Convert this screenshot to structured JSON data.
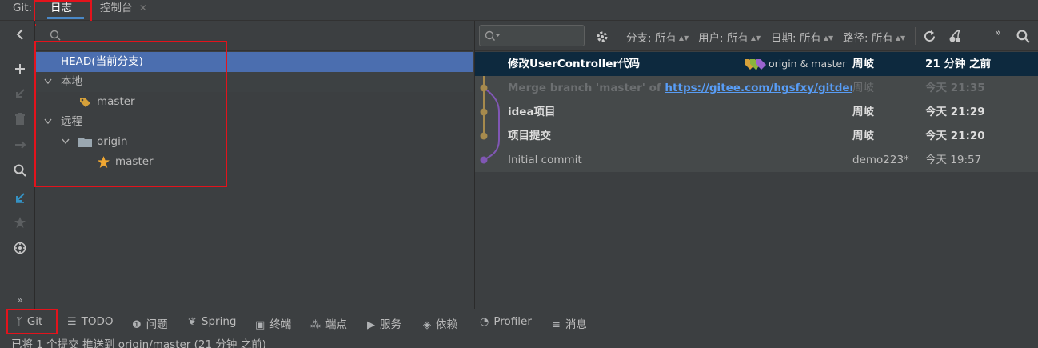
{
  "header": {
    "tool_label": "Git:",
    "tabs": [
      {
        "label": "日志",
        "active": true
      },
      {
        "label": "控制台",
        "close": "✕"
      }
    ]
  },
  "branches": {
    "items": [
      {
        "label": "HEAD(当前分支)",
        "selected": true
      },
      {
        "label": "本地",
        "expanded": true
      },
      {
        "label": "master",
        "icon": "tag-icon"
      },
      {
        "label": "远程",
        "expanded": true
      },
      {
        "label": "origin",
        "icon": "folder-icon",
        "expanded": true
      },
      {
        "label": "master",
        "icon": "star-icon"
      }
    ]
  },
  "log_toolbar": {
    "filters": [
      {
        "label": "分支: 所有"
      },
      {
        "label": "用户: 所有"
      },
      {
        "label": "日期: 所有"
      },
      {
        "label": "路径: 所有"
      }
    ]
  },
  "commits": [
    {
      "message": "修改UserController代码",
      "refs": "origin & master",
      "author": "周岐",
      "date": "21 分钟 之前",
      "bold": true,
      "selected": true
    },
    {
      "message": "Merge branch 'master' of ",
      "link": "https://gitee.com/hgsfxy/gitdemo",
      "author": "周岐",
      "date": "今天 21:35",
      "bold": true,
      "dim": true
    },
    {
      "message": "idea项目",
      "author": "周岐",
      "date": "今天 21:29",
      "bold": true
    },
    {
      "message": "项目提交",
      "author": "周岐",
      "date": "今天 21:20",
      "bold": true
    },
    {
      "message": "Initial commit",
      "author": "demo223*",
      "date": "今天 19:57",
      "bold": false
    }
  ],
  "bottom_tabs": [
    {
      "label": "Git",
      "icon": "git-branch-icon"
    },
    {
      "label": "TODO",
      "icon": "list-icon"
    },
    {
      "label": "问题",
      "icon": "problems-icon"
    },
    {
      "label": "Spring",
      "icon": "spring-leaf-icon"
    },
    {
      "label": "终端",
      "icon": "terminal-icon"
    },
    {
      "label": "端点",
      "icon": "endpoints-icon"
    },
    {
      "label": "服务",
      "icon": "services-icon"
    },
    {
      "label": "依赖",
      "icon": "dependencies-icon"
    },
    {
      "label": "Profiler",
      "icon": "profiler-icon"
    },
    {
      "label": "消息",
      "icon": "messages-icon"
    }
  ],
  "status": {
    "text": "已将 1 个提交 推送到 origin/master (21 分钟 之前)"
  },
  "colors": {
    "background": "#3c3f41",
    "selection": "#4b6eaf",
    "commit_selected": "#0d293e",
    "graph_main": "#a68a4d",
    "graph_branch": "#8057b4",
    "link": "#589df6",
    "highlight_box": "#e3131c"
  }
}
